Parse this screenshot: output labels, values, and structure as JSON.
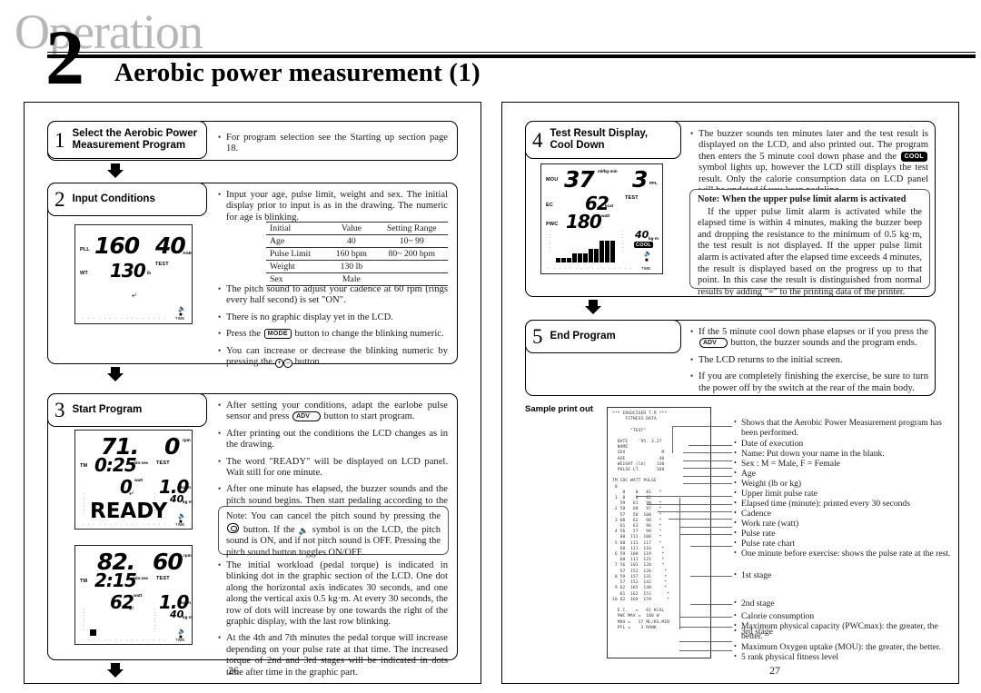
{
  "header": {
    "watermark": "Operation",
    "chapter_number": "2",
    "title": "Aerobic power measurement (1)"
  },
  "pages": {
    "left_number": "26",
    "right_number": "27"
  },
  "steps": [
    {
      "number": "1",
      "label_line1": "Select the Aerobic Power",
      "label_line2": "Measurement Program",
      "bullets": [
        "For program selection see the Starting up section page 18."
      ]
    },
    {
      "number": "2",
      "label_line1": "Input Conditions",
      "label_line2": "",
      "bullets": [
        "Input your age, pulse limit, weight and sex. The initial display prior to input is as in the drawing. The numeric for age is blinking.",
        "The pitch sound to adjust your cadence at 60 rpm (rings every half second) is set \"ON\".",
        "There is no graphic display yet in the LCD.",
        "Press the MODE button to change the blinking numeric.",
        "You can increase or decrease the blinking numeric by pressing the +/- button."
      ]
    },
    {
      "number": "3",
      "label_line1": "Start Program",
      "label_line2": "",
      "bullets": [
        "After setting your conditions, adapt the earlobe pulse sensor and press ADV button to start program.",
        "After printing out the conditions the LCD changes as in the drawing.",
        "The word \"READY\" will be displayed on LCD panel. Wait still for one minute.",
        "After one minute has elapsed, the buzzer sounds and the pitch sound begins. Then start pedaling according to the pitch sound.",
        "The initial workload (pedal torque) is indicated in blinking dot in the graphic section of the LCD. One dot along the horizontal axis indicates 30 seconds, and one along the vertical axis 0.5 kg·m. At every 30 seconds, the row of dots will increase by one towards the right of the graphic display, with the last row blinking.",
        "At the 4th and 7th minutes the pedal torque will increase depending on your pulse rate at that time. The increased torque of 2nd and 3rd stages will be indicated in dots time after time in the graphic part."
      ]
    },
    {
      "number": "4",
      "label_line1": "Test Result Display,",
      "label_line2": "Cool Down",
      "bullets": [
        "The buzzer sounds ten minutes later and the test result is displayed on the LCD, and also printed out. The program then enters the 5 minute cool down phase and the COOL symbol lights up, however the LCD still displays the test result. Only the calorie consumption data on LCD panel will be updated if you keep pedaling."
      ]
    },
    {
      "number": "5",
      "label_line1": "End Program",
      "label_line2": "",
      "bullets": [
        "If the 5 minute cool down phase elapses or if you press the ADV button, the buzzer sounds and the program ends.",
        "The LCD returns to the initial screen.",
        "If you are completely finishing the exercise, be sure to turn the power off by the switch at the rear of the main body."
      ]
    }
  ],
  "bullet_keys": {
    "mode": "MODE",
    "adv": "ADV",
    "plus": "+",
    "minus": "–"
  },
  "conditions_table": {
    "headers": [
      "Initial",
      "Value",
      "Setting Range"
    ],
    "rows": [
      [
        "Age",
        "40",
        "10~ 99"
      ],
      [
        "Pulse Limit",
        "160 bpm",
        "80~ 200 bpm"
      ],
      [
        "Weight",
        "130 lb",
        ""
      ],
      [
        "Sex",
        "Male",
        ""
      ]
    ]
  },
  "note_pitch": {
    "title": "Note:",
    "body": "You can cancel the pitch sound by pressing the button. If the symbol is on the LCD, the pitch sound is ON, and if not pitch sound is OFF. Pressing the pitch sound button toggles ON/OFF."
  },
  "note_alarm": {
    "title": "Note: When the upper pulse limit alarm is activated",
    "body": "If the upper pulse limit alarm is activated while the elapsed time is within 4 minutes, making the buzzer beep and dropping the resistance to the minimum of 0.5 kg·m, the test result is not displayed. If the upper pulse limit alarm is activated after the elapsed time exceeds 4 minutes, the result is displayed based on the progress up to that point. In this case the result is distinguished from normal results by adding \"=\" to the printing data of the printer."
  },
  "lcd_step2": {
    "pll_label": "PLL",
    "pll_value": "160",
    "age_value": "40",
    "age_label": "AGE",
    "test_label": "TEST",
    "wt_label": "WT",
    "wt_value": "130",
    "wt_unit": "lb",
    "time_label": "TIME"
  },
  "lcd_step3a": {
    "pulse_value": "71.",
    "rpm_value": "0",
    "rpm_unit": "rpm",
    "tm_label": "TM",
    "time_value": "0:25",
    "time_unit": "min:sec",
    "test_label": "TEST",
    "watt_value": "0",
    "watt_unit": "watt",
    "kgm_value": "1.0",
    "kgm_unit": "kg·m",
    "kgm2_value": "40",
    "kgm2_unit": "kg·m",
    "ready_text": "READY",
    "time_label": "TIME"
  },
  "lcd_step3b": {
    "pulse_value": "82.",
    "rpm_value": "60",
    "rpm_unit": "rpm",
    "tm_label": "TM",
    "time_value": "2:15",
    "time_unit": "min:sec",
    "test_label": "TEST",
    "watt_value": "62",
    "watt_unit": "watt",
    "kgm_value": "1.0",
    "kgm_unit": "kg·m",
    "kgm2_value": "40",
    "kgm2_unit": "kg·m",
    "time_label": "TIME"
  },
  "lcd_step4": {
    "mou_label": "MOU",
    "mou_value": "37",
    "mou_unit": "ml/kg·min",
    "pfl_value": "3",
    "pfl_label": "PFL",
    "test_label": "TEST",
    "ec_label": "EC",
    "ec_value": "62",
    "ec_unit": "kcal",
    "pwc_label": "PWC",
    "pwc_value": "180",
    "pwc_unit": "watt",
    "kgm_value": "40",
    "kgm_unit": "kg·m",
    "cool_label": "COOL",
    "time_label": "TIME"
  },
  "printout": {
    "caption": "Sample print out",
    "lines": [
      "*** ERGOCISER T.R ***",
      "     FITNESS DATA",
      "",
      "       \"TEST\"",
      "",
      "  DATE    '95. 3.27",
      "  NAME",
      "  SEX              M",
      "  AGE             40",
      "  WEIGHT (lb)    130",
      "  PULSE LT.      160",
      "",
      "TM CDC WATT PULSE",
      " 0",
      "    0    0   81   *",
      " 1  0    0   82   *",
      "   59   61   90   *",
      " 2 58   60   97   *",
      "   57   58  100   *",
      " 3 60   62   98   *",
      "   61   63   96   *",
      " 4 56   57   99   *",
      "   60  111  106   *",
      " 5 60  111  117   *",
      "   60  111  116    *",
      " 6 59  109  119    *",
      "   60  111  121    *",
      " 7 56  103  120    *",
      "   57  152  126     *",
      " 8 59  157  131     *",
      "   57  152  142     *",
      " 9 62  165  148     *",
      "   61  162  151      *",
      "10 62  169  159      *",
      "",
      "  E.C.   =   61 KCAL",
      "  PWC MAX =  180 W",
      "  MOU =   37 ML/KG.MIN",
      "  PFL =    3 RANK"
    ]
  },
  "annotations": [
    "Shows that the Aerobic Power Measurement program has been performed.",
    "Date of execution",
    "Name: Put down your name in the blank.",
    "Sex : M = Male, F = Female",
    "Age",
    "Weight (lb or kg)",
    "Upper limit pulse rate",
    "Elapsed time (minute): printed every 30 seconds",
    "Cadence",
    "Work rate (watt)",
    "Pulse rate",
    "Pulse rate chart",
    "One minute before exercise: shows the pulse rate at the rest.",
    "1st stage",
    "2nd stage",
    "3rd stage",
    "Calorie consumption",
    "Maximum physical capacity (PWCmax): the greater, the better.",
    "Maximum Oxygen uptake (MOU): the greater, the better.",
    "5 rank physical fitness level"
  ]
}
